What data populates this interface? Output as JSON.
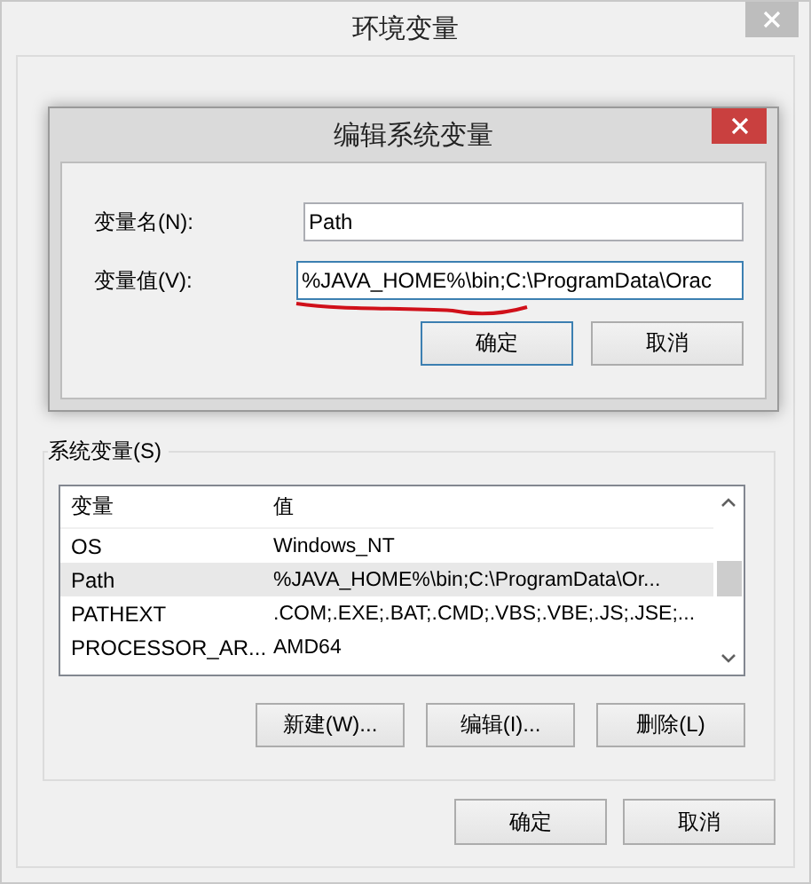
{
  "window": {
    "title": "环境变量"
  },
  "system_variables": {
    "label": "系统变量(S)",
    "columns": [
      "变量",
      "值"
    ],
    "rows": [
      {
        "name": "OS",
        "value": "Windows_NT",
        "selected": false
      },
      {
        "name": "Path",
        "value": "%JAVA_HOME%\\bin;C:\\ProgramData\\Or...",
        "selected": true
      },
      {
        "name": "PATHEXT",
        "value": ".COM;.EXE;.BAT;.CMD;.VBS;.VBE;.JS;.JSE;...",
        "selected": false
      },
      {
        "name": "PROCESSOR_AR...",
        "value": "AMD64",
        "selected": false
      }
    ],
    "buttons": [
      "新建(W)...",
      "编辑(I)...",
      "删除(L)"
    ]
  },
  "buttons": [
    "确定",
    "取消"
  ],
  "dialog": {
    "title": "编辑系统变量",
    "name_label": "变量名(N):",
    "name_value": "Path",
    "value_label": "变量值(V):",
    "value_value": "%JAVA_HOME%\\bin;C:\\ProgramData\\Orac",
    "buttons": [
      "确定",
      "取消"
    ]
  }
}
